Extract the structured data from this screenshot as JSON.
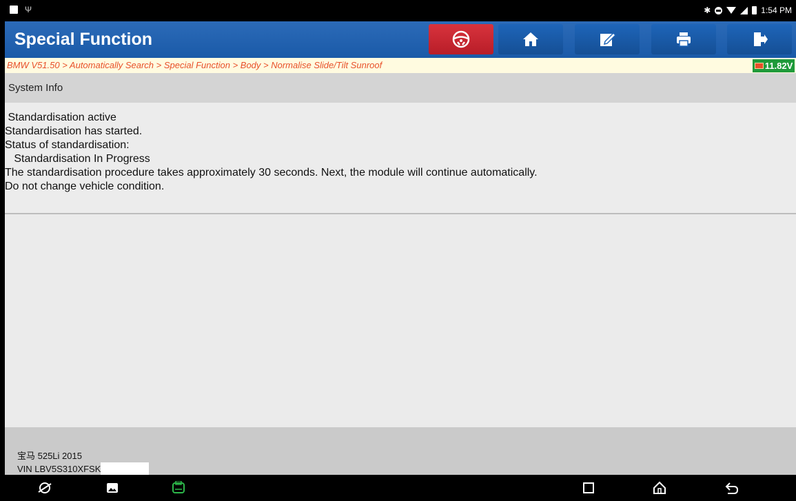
{
  "status_bar": {
    "time": "1:54 PM",
    "left_icons": [
      "image-notification-icon",
      "usb-icon"
    ],
    "right_icons": [
      "bluetooth-icon",
      "do-not-disturb-icon",
      "wifi-icon",
      "signal-icon",
      "battery-icon"
    ]
  },
  "header": {
    "title": "Special Function",
    "buttons": [
      {
        "name": "remote-diagnosis-icon",
        "color": "#c8212c"
      },
      {
        "name": "home-icon"
      },
      {
        "name": "edit-report-icon"
      },
      {
        "name": "print-icon"
      },
      {
        "name": "exit-icon"
      }
    ]
  },
  "breadcrumb": "BMW V51.50 > Automatically Search > Special Function > Body > Normalise Slide/Tilt Sunroof",
  "voltage": "11.82V",
  "section": {
    "title": "System Info"
  },
  "messages": [
    " Standardisation active",
    "Standardisation has started.",
    "Status of standardisation:",
    "   Standardisation In Progress",
    "The standardisation procedure takes approximately 30 seconds. Next, the module will continue automatically.",
    "Do not change vehicle condition."
  ],
  "footer": {
    "vehicle": "宝马 525Li 2015",
    "vin": "VIN LBV5S310XFSK"
  },
  "nav_bar": [
    "browser-icon",
    "gallery-icon",
    "vci-icon",
    "recents-icon",
    "home-nav-icon",
    "back-icon"
  ],
  "colors": {
    "header_blue": "#1a5aa8",
    "breadcrumb_text": "#e8502a",
    "voltage_green": "#1f9a3a",
    "vci_green": "#2db84a"
  }
}
